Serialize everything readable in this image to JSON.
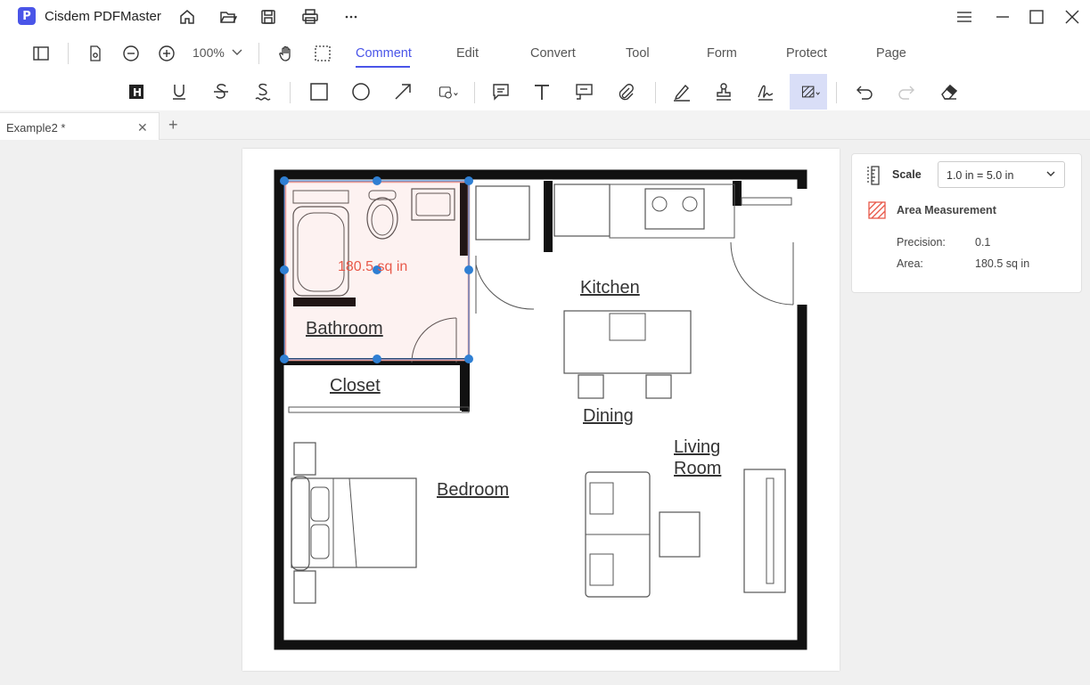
{
  "app": {
    "title": "Cisdem PDFMaster",
    "logo_letter": "P"
  },
  "titlebar": {
    "icons": [
      "home-icon",
      "open-folder-icon",
      "save-icon",
      "print-icon",
      "more-icon"
    ],
    "window_controls": [
      "menu-icon",
      "minimize-icon",
      "maximize-icon",
      "close-icon"
    ]
  },
  "toolbar": {
    "zoom": "100%",
    "tabs": [
      {
        "label": "Comment",
        "active": true
      },
      {
        "label": "Edit"
      },
      {
        "label": "Convert"
      },
      {
        "label": "Tool"
      },
      {
        "label": "Form"
      },
      {
        "label": "Protect"
      },
      {
        "label": "Page"
      }
    ]
  },
  "comment_tools": [
    "highlight",
    "underline",
    "strikethrough",
    "squiggly",
    "rectangle",
    "ellipse",
    "arrow",
    "shapes",
    "note",
    "text",
    "callout",
    "attachment",
    "pencil",
    "stamp",
    "signature",
    "area-measure",
    "undo",
    "redo",
    "eraser"
  ],
  "document_tab": {
    "name": "Example2 *"
  },
  "floorplan": {
    "measurement_label": "180.5 sq in",
    "rooms": [
      "Kitchen",
      "Bathroom",
      "Closet",
      "Dining",
      "Living",
      "Room",
      "Bedroom"
    ]
  },
  "panel": {
    "scale_label": "Scale",
    "scale_value": "1.0 in = 5.0 in",
    "measurement_title": "Area Measurement",
    "precision_label": "Precision:",
    "precision_value": "0.1",
    "area_label": "Area:",
    "area_value": "180.5 sq in"
  },
  "colors": {
    "accent": "#4a55e8",
    "measure": "#e8594a",
    "handle": "#2f7fd3"
  }
}
